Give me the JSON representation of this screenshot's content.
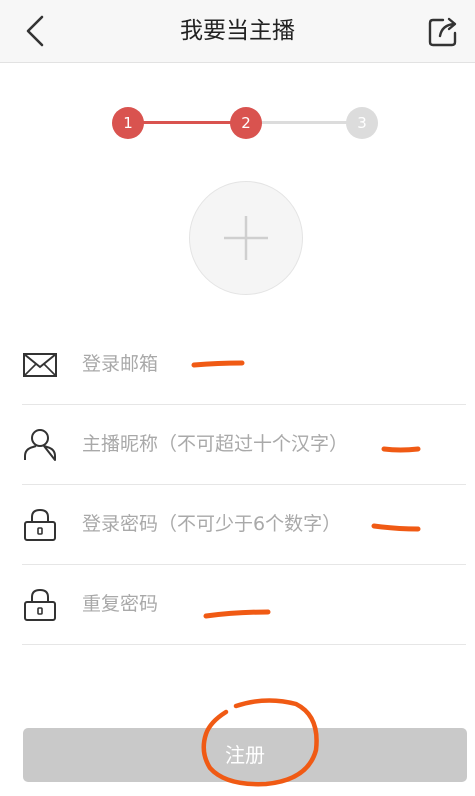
{
  "header": {
    "title": "我要当主播",
    "back_icon": "back-chevron-icon",
    "share_icon": "share-icon"
  },
  "steps": [
    {
      "label": "1",
      "state": "done"
    },
    {
      "label": "2",
      "state": "current"
    },
    {
      "label": "3",
      "state": "pending"
    }
  ],
  "avatar": {
    "icon": "plus-icon"
  },
  "form": {
    "email_placeholder": "登录邮箱",
    "nickname_placeholder": "主播昵称（不可超过十个汉字）",
    "password_placeholder": "登录密码（不可少于6个数字）",
    "confirm_password_placeholder": "重复密码"
  },
  "register_label": "注册",
  "colors": {
    "accent": "#d9534f",
    "inactive_step": "#dcdcdc",
    "button_disabled": "#c9c9c9",
    "annotation": "#f05a14"
  }
}
